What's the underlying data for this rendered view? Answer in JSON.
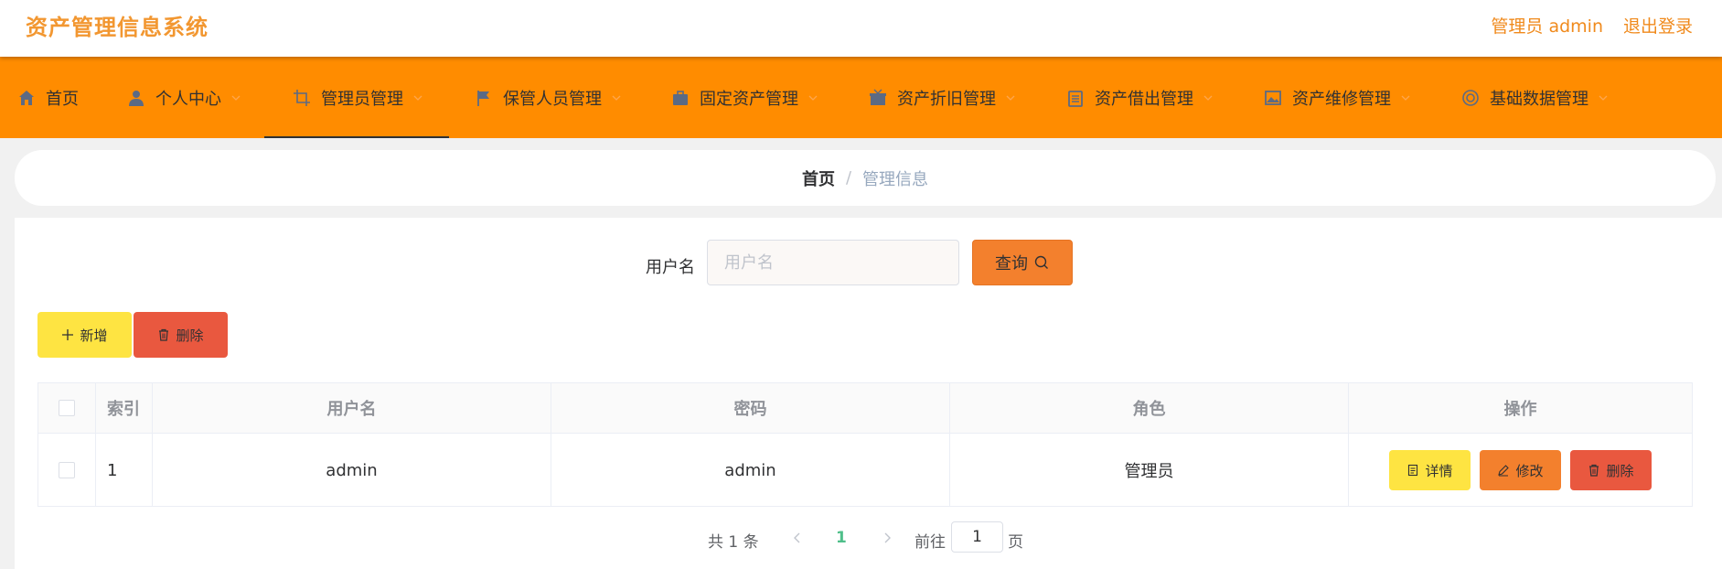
{
  "header": {
    "app_title": "资产管理信息系统",
    "user_label": "管理员 admin",
    "logout_label": "退出登录"
  },
  "nav": {
    "items": [
      {
        "label": "首页",
        "icon": "home-icon"
      },
      {
        "label": "个人中心",
        "icon": "user-icon"
      },
      {
        "label": "管理员管理",
        "icon": "crop-icon",
        "active": true
      },
      {
        "label": "保管人员管理",
        "icon": "flag-icon"
      },
      {
        "label": "固定资产管理",
        "icon": "briefcase-icon"
      },
      {
        "label": "资产折旧管理",
        "icon": "present-icon"
      },
      {
        "label": "资产借出管理",
        "icon": "clipboard-icon"
      },
      {
        "label": "资产维修管理",
        "icon": "picture-icon"
      },
      {
        "label": "基础数据管理",
        "icon": "circle-icon"
      }
    ]
  },
  "breadcrumb": {
    "home": "首页",
    "separator": "/",
    "current": "管理信息"
  },
  "search": {
    "label": "用户名",
    "placeholder": "用户名",
    "value": "",
    "button_label": "查询"
  },
  "actions": {
    "add_label": "新增",
    "delete_label": "删除"
  },
  "table": {
    "columns": [
      "索引",
      "用户名",
      "密码",
      "角色",
      "操作"
    ],
    "rows": [
      {
        "index": "1",
        "username": "admin",
        "password": "admin",
        "role": "管理员"
      }
    ],
    "row_actions": {
      "detail_label": "详情",
      "edit_label": "修改",
      "delete_label": "删除"
    }
  },
  "pagination": {
    "total_text": "共 1 条",
    "current_page": "1",
    "goto_label": "前往",
    "goto_value": "1",
    "page_unit": "页"
  },
  "colors": {
    "brand_orange": "#ff8c00",
    "title_orange": "#f29731",
    "add_yellow": "#fee442",
    "query_orange": "#f3802d",
    "delete_red": "#e9583f",
    "page_green": "#4fbf8a"
  }
}
